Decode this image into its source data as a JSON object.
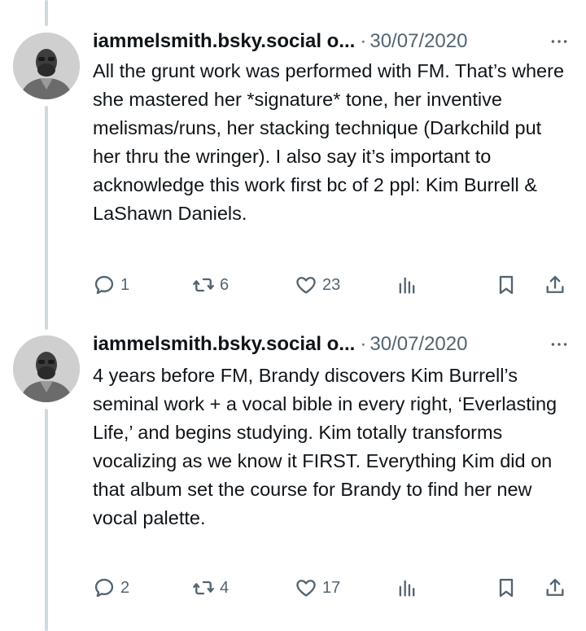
{
  "tweets": [
    {
      "handle": "iammelsmith.bsky.social o...",
      "separator": "·",
      "date": "30/07/2020",
      "text": "All the grunt work was performed with FM. That’s where she mastered her *signature* tone, her inventive melismas/runs, her stacking technique (Darkchild put her thru the wringer). I also say it’s important to acknowledge this work first bc of 2 ppl: Kim Burrell & LaShawn Daniels.",
      "replies": "1",
      "retweets": "6",
      "likes": "23"
    },
    {
      "handle": "iammelsmith.bsky.social o...",
      "separator": "·",
      "date": "30/07/2020",
      "text": "4 years before FM, Brandy discovers Kim Burrell’s seminal work + a vocal bible in every right, ‘Everlasting Life,’ and begins studying. Kim totally transforms vocalizing as we know it FIRST. Everything Kim did on that album set the course for Brandy to find her new vocal palette.",
      "replies": "2",
      "retweets": "4",
      "likes": "17"
    }
  ],
  "icons": {
    "reply": "reply-icon",
    "retweet": "retweet-icon",
    "like": "heart-icon",
    "views": "analytics-icon",
    "bookmark": "bookmark-icon",
    "share": "share-icon",
    "more": "more-icon"
  },
  "colors": {
    "text": "#0f1419",
    "secondary": "#536471",
    "thread_line": "#cfd9de"
  }
}
